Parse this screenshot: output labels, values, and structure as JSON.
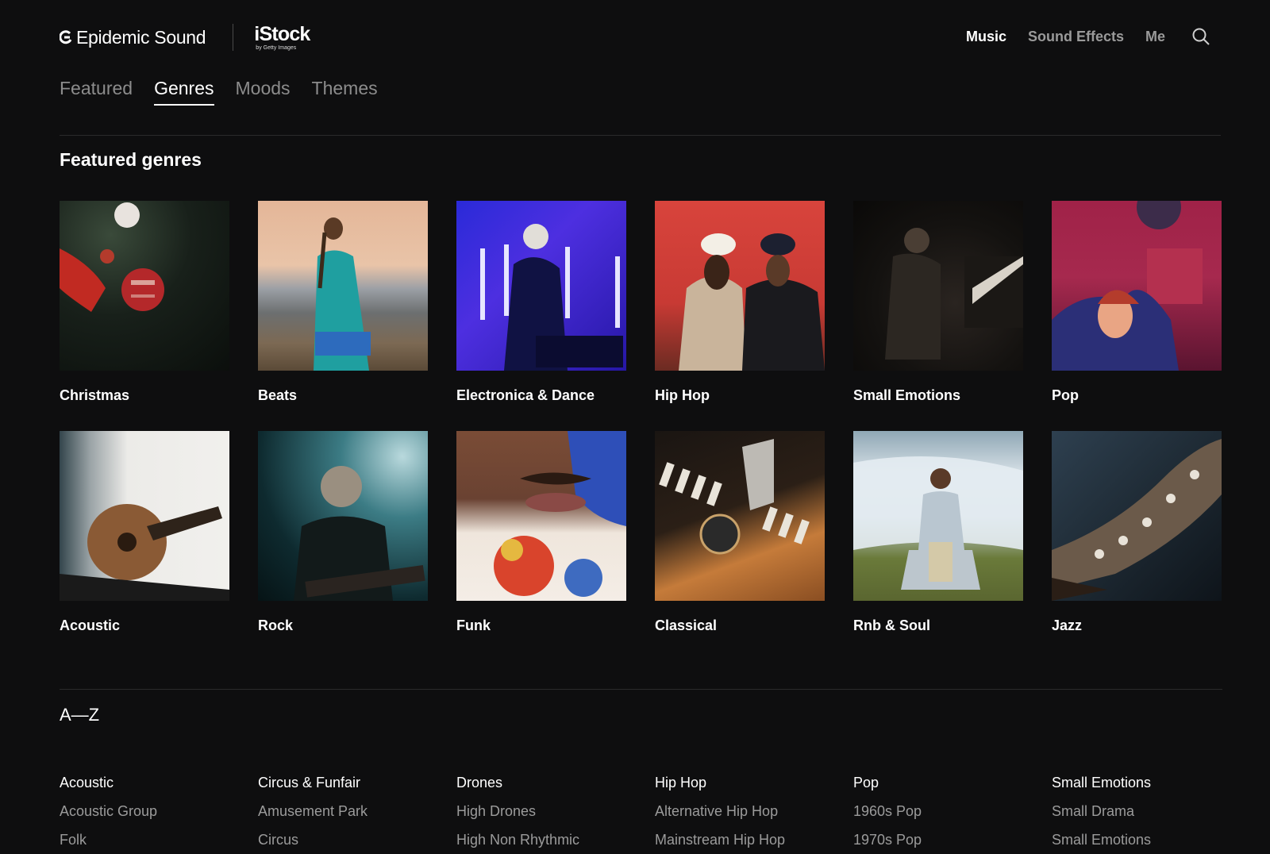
{
  "brand": {
    "name": "Epidemic Sound",
    "partner": "iStock",
    "partner_sub": "by Getty Images"
  },
  "nav": {
    "music": "Music",
    "sound_effects": "Sound Effects",
    "me": "Me"
  },
  "tabs": [
    "Featured",
    "Genres",
    "Moods",
    "Themes"
  ],
  "active_tab": "Genres",
  "featured": {
    "title": "Featured genres",
    "items": [
      {
        "label": "Christmas"
      },
      {
        "label": "Beats"
      },
      {
        "label": "Electronica & Dance"
      },
      {
        "label": "Hip Hop"
      },
      {
        "label": "Small Emotions"
      },
      {
        "label": "Pop"
      },
      {
        "label": "Acoustic"
      },
      {
        "label": "Rock"
      },
      {
        "label": "Funk"
      },
      {
        "label": "Classical"
      },
      {
        "label": "Rnb & Soul"
      },
      {
        "label": "Jazz"
      }
    ]
  },
  "az": {
    "title": "A—Z",
    "columns": [
      {
        "head": "Acoustic",
        "items": [
          "Acoustic Group",
          "Folk"
        ]
      },
      {
        "head": "Circus & Funfair",
        "items": [
          "Amusement Park",
          "Circus"
        ]
      },
      {
        "head": "Drones",
        "items": [
          "High Drones",
          "High Non Rhythmic"
        ]
      },
      {
        "head": "Hip Hop",
        "items": [
          "Alternative Hip Hop",
          "Mainstream Hip Hop"
        ]
      },
      {
        "head": "Pop",
        "items": [
          "1960s Pop",
          "1970s Pop"
        ]
      },
      {
        "head": "Small Emotions",
        "items": [
          "Small Drama",
          "Small Emotions"
        ]
      }
    ]
  }
}
